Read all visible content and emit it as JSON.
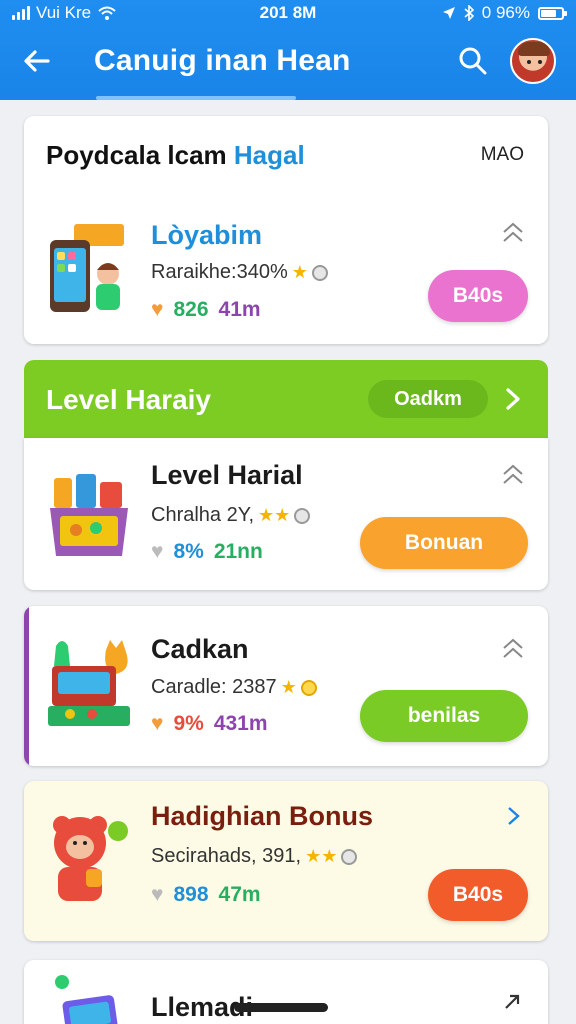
{
  "status_bar": {
    "carrier": "Vui Kre",
    "time": "201 8M",
    "battery": "0 96%"
  },
  "app_bar": {
    "title": "Canuig inan Hean"
  },
  "section_header": {
    "title_left": "Poydcala lcam",
    "title_accent": "Hagal",
    "right_label": "MAO"
  },
  "banner": {
    "label": "Level Haraiy",
    "pill": "Oadkm"
  },
  "cards": [
    {
      "title": "Lòyabim",
      "meta": "Raraikhe:340%",
      "stat1": "826",
      "stat2": "41m",
      "button": "B40s",
      "button_color": "#ea73cf",
      "title_color": "#1e8fd8"
    },
    {
      "title": "Level Harial",
      "meta": "Chralha 2Y,",
      "stat1": "8%",
      "stat2": "21nn",
      "button": "Bonuan",
      "button_color": "#f9a22e",
      "title_color": "#1b1b1b"
    },
    {
      "title": "Cadkan",
      "meta": "Caradle: 2387",
      "stat1": "9%",
      "stat2": "431m",
      "button": "benilas",
      "button_color": "#7bcb26",
      "title_color": "#1b1b1b"
    },
    {
      "title": "Hadighian Bonus",
      "meta": "Secirahads, 391,",
      "stat1": "898",
      "stat2": "47m",
      "button": "B40s",
      "button_color": "#f25c2b",
      "title_color": "#7a1e0e"
    },
    {
      "title": "Llemadi"
    }
  ],
  "colors": {
    "app_bar": "#1a84e8",
    "banner_green": "#7ccc24",
    "accent_blue": "#1e8fd8"
  }
}
